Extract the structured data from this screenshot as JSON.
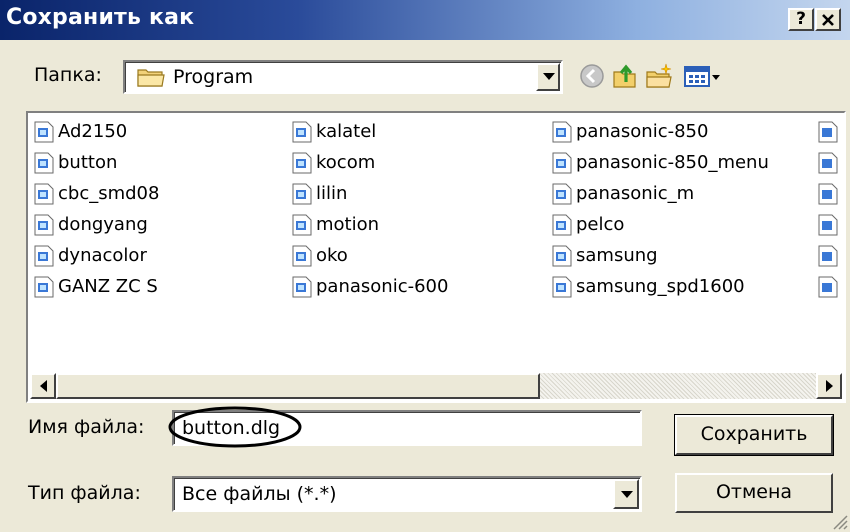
{
  "window": {
    "title": "Сохранить как",
    "help_button": "?",
    "close_button": "×"
  },
  "location": {
    "label": "Папка:",
    "folder": "Program"
  },
  "toolbar": {
    "icons": [
      "back-icon",
      "up-folder-icon",
      "new-folder-icon",
      "view-menu-icon"
    ]
  },
  "files": [
    [
      "Ad2150",
      "button",
      "cbc_smd08",
      "dongyang",
      "dynacolor",
      "GANZ ZC S"
    ],
    [
      "kalatel",
      "kocom",
      "lilin",
      "motion",
      "oko",
      "panasonic-600"
    ],
    [
      "panasonic-850",
      "panasonic-850_menu",
      "panasonic_m",
      "pelco",
      "samsung",
      "samsung_spd1600"
    ]
  ],
  "filename": {
    "label": "Имя файла:",
    "value": "button.dlg"
  },
  "filetype": {
    "label": "Тип файла:",
    "value": "Все файлы (*.*)"
  },
  "buttons": {
    "save": "Сохранить",
    "cancel": "Отмена"
  },
  "colors": {
    "title_start": "#0a246a",
    "title_end": "#c4d6ee",
    "face": "#ece9d8",
    "highlight_ellipse": "#000000"
  }
}
